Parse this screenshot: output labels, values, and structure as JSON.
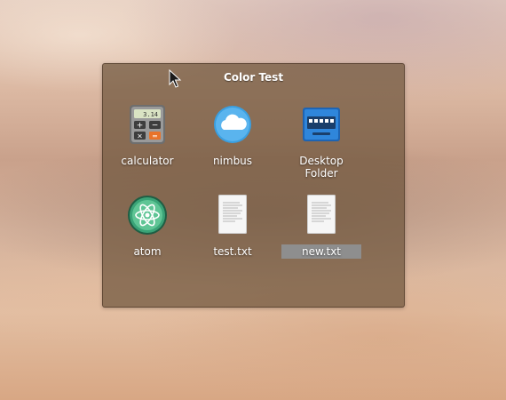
{
  "window": {
    "title": "Color Test"
  },
  "items": [
    {
      "label": "calculator",
      "icon": "calculator-icon",
      "icon_text": "3.14"
    },
    {
      "label": "nimbus",
      "icon": "cloud-icon"
    },
    {
      "label": "Desktop Folder",
      "icon": "desktop-folder-icon"
    },
    {
      "label": "atom",
      "icon": "atom-icon"
    },
    {
      "label": "test.txt",
      "icon": "text-file-icon"
    },
    {
      "label": "new.txt",
      "icon": "text-file-icon",
      "selected": true
    }
  ]
}
